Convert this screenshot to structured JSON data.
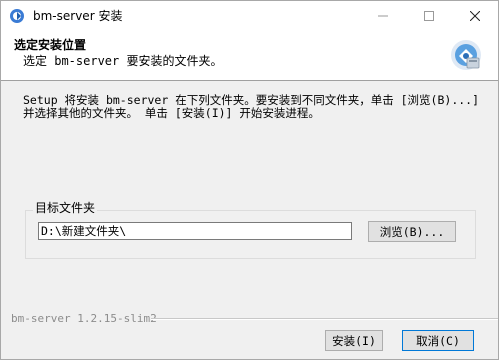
{
  "window": {
    "title": "bm-server 安装",
    "controls": {
      "minimize_icon": "minimize-icon",
      "maximize_icon": "maximize-icon",
      "close_icon": "close-icon"
    }
  },
  "header": {
    "title": "选定安装位置",
    "subtitle": "选定 bm-server 要安装的文件夹。"
  },
  "intro": {
    "line1": "Setup 将安装 bm-server 在下列文件夹。要安装到不同文件夹，单击 [浏览(B)...]",
    "line2": "并选择其他的文件夹。 单击 [安装(I)] 开始安装进程。"
  },
  "destination": {
    "group_label": "目标文件夹",
    "path_value": "D:\\新建文件夹\\",
    "browse_label": "浏览(B)..."
  },
  "footer": {
    "version": "bm-server 1.2.15-slim2",
    "install_label": "安装(I)",
    "cancel_label": "取消(C)"
  },
  "colors": {
    "accent": "#0078d7",
    "titlebar_bg": "#ffffff",
    "body_bg": "#f0f0f0"
  }
}
